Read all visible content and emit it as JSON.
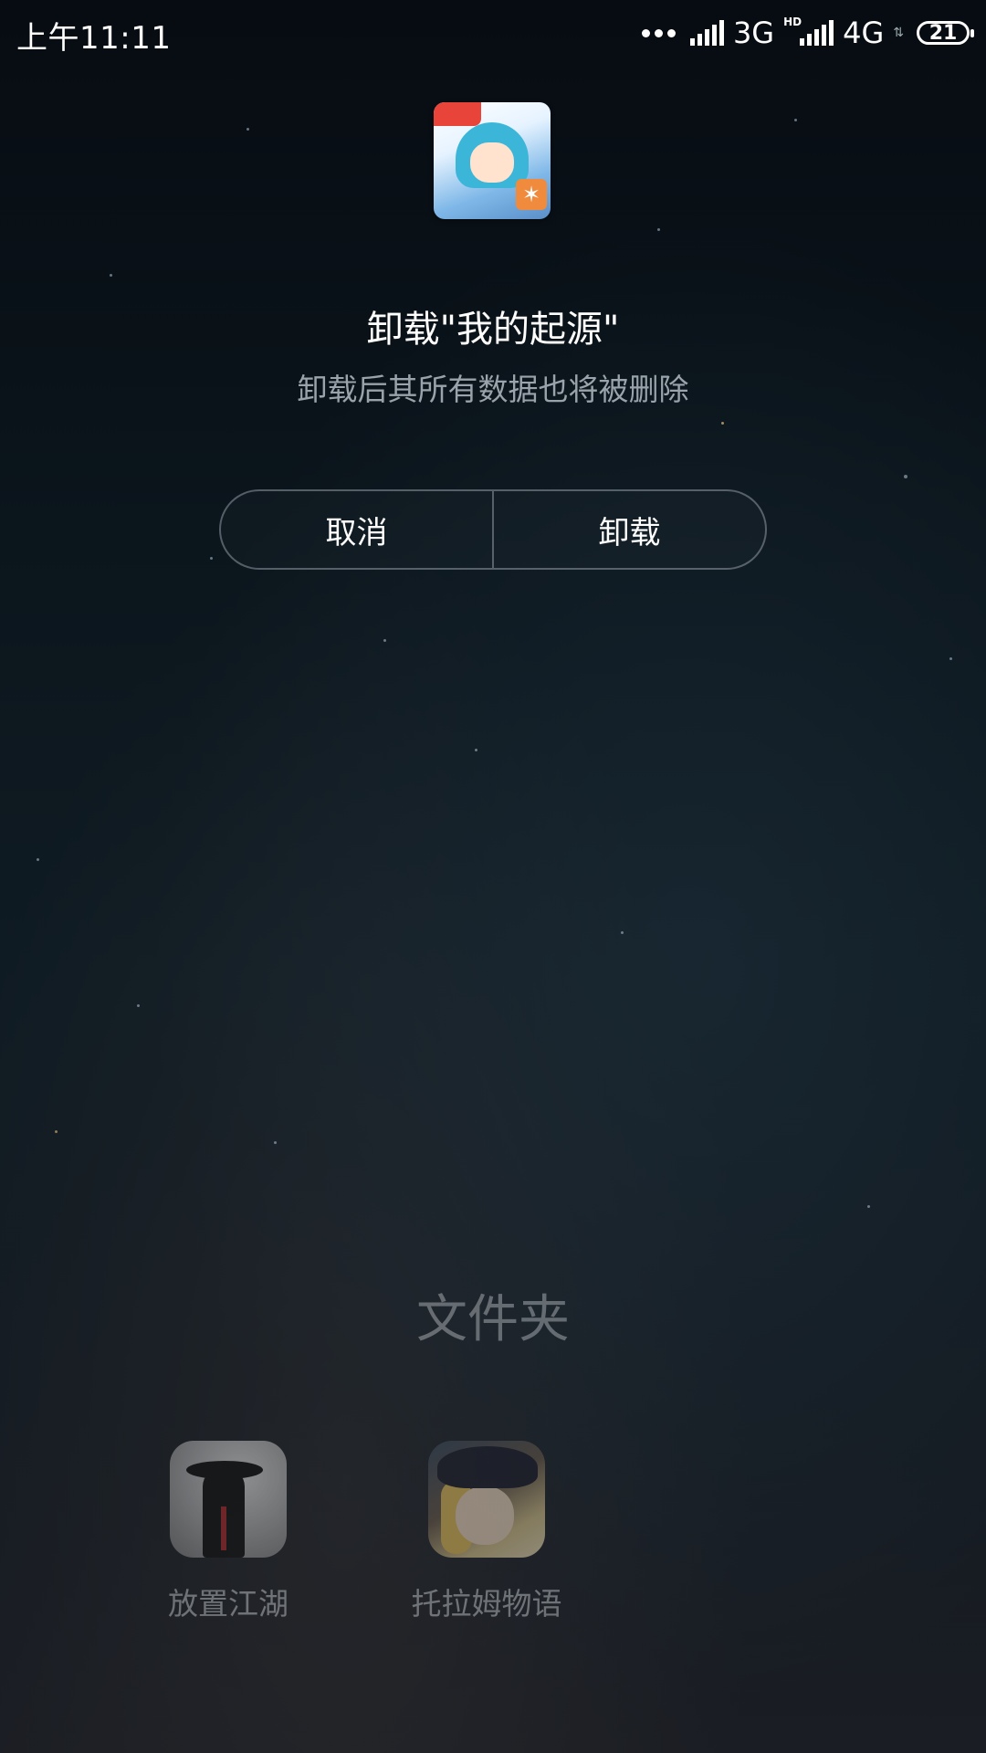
{
  "status_bar": {
    "time": "上午11:11",
    "network_1": "3G",
    "hd_label": "HD",
    "network_2": "4G",
    "battery": "21"
  },
  "dialog": {
    "app_icon": "game-app-icon",
    "title": "卸载\"我的起源\"",
    "message": "卸载后其所有数据也将被删除",
    "cancel_label": "取消",
    "uninstall_label": "卸载"
  },
  "folder": {
    "title": "文件夹",
    "apps": [
      {
        "label": "放置江湖",
        "icon": "fangzhi-jianghu-app-icon"
      },
      {
        "label": "托拉姆物语",
        "icon": "tuolamu-wuyu-app-icon"
      }
    ]
  },
  "colors": {
    "background_top": "#070c12",
    "background_bottom": "#1a1d23",
    "text_primary": "#ffffff",
    "text_secondary": "#9aa3ab",
    "button_border": "#aab4be"
  }
}
